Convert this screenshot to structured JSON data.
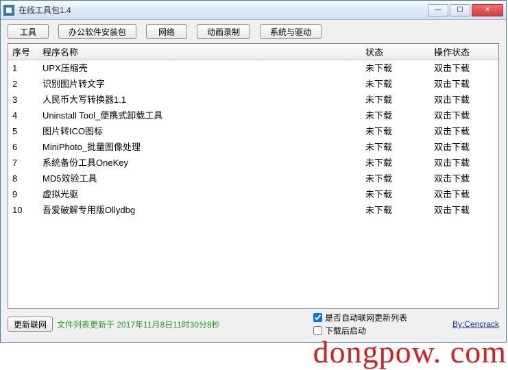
{
  "window": {
    "title": "在线工具包1.4"
  },
  "toolbar": {
    "tools": "工具",
    "office": "办公软件安装包",
    "network": "网络",
    "animation": "动画录制",
    "system": "系统与驱动"
  },
  "headers": {
    "idx": "序号",
    "name": "程序名称",
    "status": "状态",
    "op": "操作状态"
  },
  "rows": [
    {
      "idx": "1",
      "name": "UPX压缩壳",
      "status": "未下载",
      "op": "双击下载"
    },
    {
      "idx": "2",
      "name": "识别图片转文字",
      "status": "未下载",
      "op": "双击下载"
    },
    {
      "idx": "3",
      "name": "人民币大写转换器1.1",
      "status": "未下载",
      "op": "双击下载"
    },
    {
      "idx": "4",
      "name": "Uninstall Tool_便携式卸载工具",
      "status": "未下载",
      "op": "双击下载"
    },
    {
      "idx": "5",
      "name": "图片转ICO图标",
      "status": "未下载",
      "op": "双击下载"
    },
    {
      "idx": "6",
      "name": "MiniPhoto_批量图像处理",
      "status": "未下载",
      "op": "双击下载"
    },
    {
      "idx": "7",
      "name": "系统备份工具OneKey",
      "status": "未下载",
      "op": "双击下载"
    },
    {
      "idx": "8",
      "name": "MD5效验工具",
      "status": "未下载",
      "op": "双击下载"
    },
    {
      "idx": "9",
      "name": "虚拟光驱",
      "status": "未下载",
      "op": "双击下载"
    },
    {
      "idx": "10",
      "name": "吾爱破解专用版Ollydbg",
      "status": "未下载",
      "op": "双击下载"
    }
  ],
  "bottom": {
    "update_btn": "更新联网",
    "update_text": "文件列表更新于 2017年11月8日11时30分8秒",
    "check_auto": "是否自动联网更新列表",
    "check_launch": "下载后启动",
    "credit": "By:Cencrack"
  },
  "watermark": "dongpow. com"
}
